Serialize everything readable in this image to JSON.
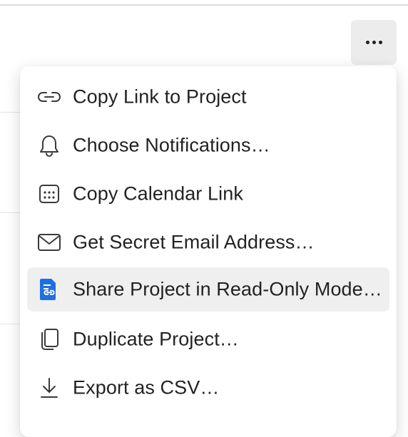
{
  "more_button": {
    "icon": "ellipsis-icon"
  },
  "menu": {
    "items": [
      {
        "label": "Copy Link to Project",
        "icon": "link-icon"
      },
      {
        "label": "Choose Notifications…",
        "icon": "bell-icon"
      },
      {
        "label": "Copy Calendar Link",
        "icon": "calendar-icon"
      },
      {
        "label": "Get Secret Email Address…",
        "icon": "envelope-icon"
      },
      {
        "label": "Share Project in Read-Only Mode…",
        "icon": "shared-document-icon",
        "highlighted": true
      },
      {
        "label": "Duplicate Project…",
        "icon": "duplicate-icon"
      },
      {
        "label": "Export as CSV…",
        "icon": "download-icon"
      }
    ]
  },
  "colors": {
    "accent": "#1e6fe0",
    "highlight": "#efefef",
    "text": "#222222"
  }
}
